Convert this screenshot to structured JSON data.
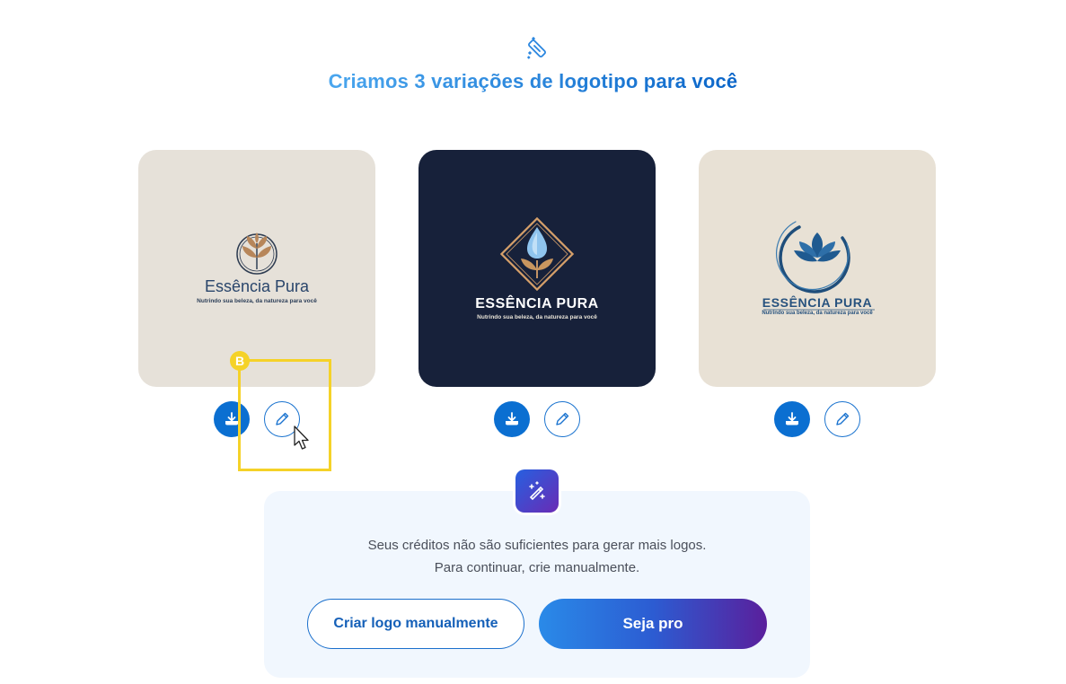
{
  "header": {
    "icon": "magic-wand-icon",
    "title": "Criamos 3 variações de logotipo para você"
  },
  "logos": [
    {
      "brand_name": "Essência Pura",
      "tagline": "Nutrindo sua beleza, da natureza para você",
      "background": "#e6e1d9",
      "emblem": "leaf-circle-emblem"
    },
    {
      "brand_name": "ESSÊNCIA PURA",
      "tagline": "Nutrindo sua beleza, da natureza para você",
      "background": "#17213a",
      "emblem": "diamond-drop-emblem"
    },
    {
      "brand_name": "ESSÊNCIA PURA",
      "tagline": "Nutrindo sua beleza, da natureza para você",
      "background": "#e8e1d5",
      "emblem": "lotus-ring-emblem"
    }
  ],
  "actions": {
    "download_icon": "download-icon",
    "edit_icon": "pencil-icon"
  },
  "annotation": {
    "badge_label": "B",
    "color": "#f5d228"
  },
  "credits_panel": {
    "icon": "magic-sparkle-icon",
    "line_1": "Seus créditos não são suficientes para gerar mais logos.",
    "line_2": "Para continuar, crie manualmente.",
    "manual_button": "Criar logo manualmente",
    "pro_button": "Seja pro"
  }
}
